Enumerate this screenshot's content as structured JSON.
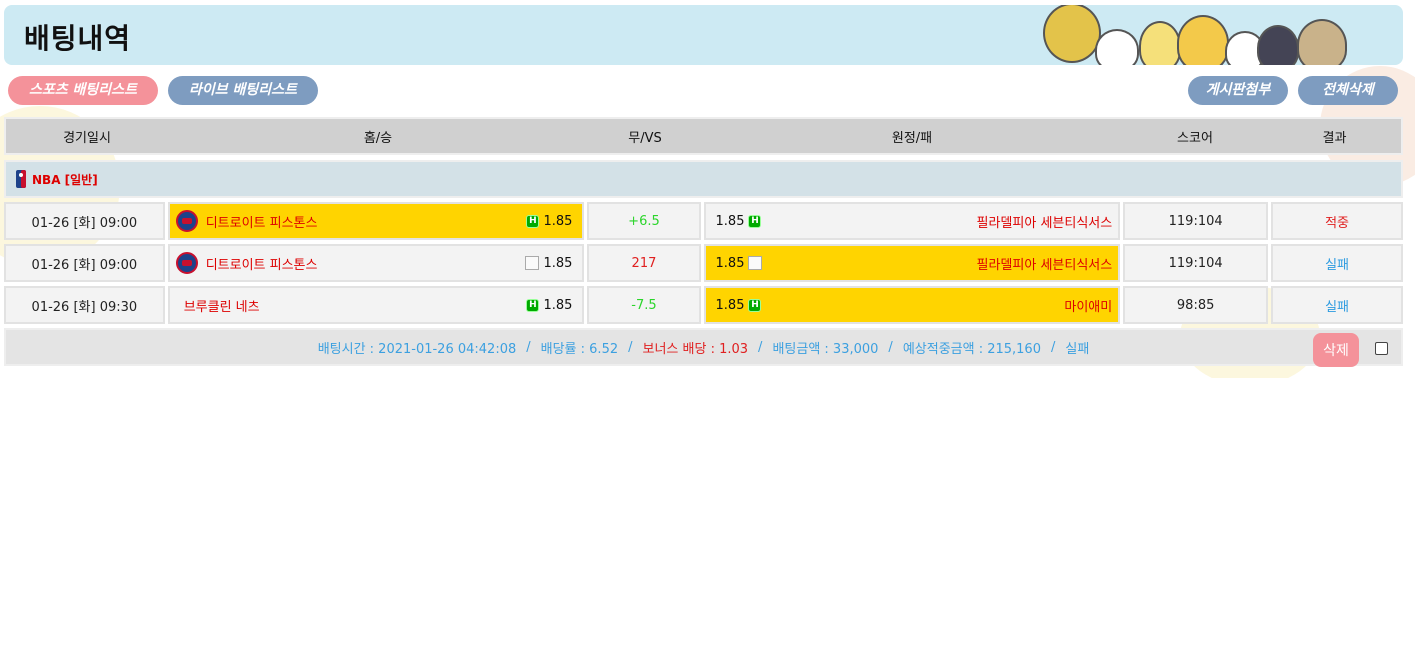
{
  "header": {
    "title": "배팅내역"
  },
  "tabs": {
    "sports": "스포츠 배팅리스트",
    "live": "라이브 배팅리스트"
  },
  "actions": {
    "board_attach": "게시판첨부",
    "delete_all": "전체삭제"
  },
  "columns": [
    "경기일시",
    "홈/승",
    "무/VS",
    "원정/패",
    "스코어",
    "결과"
  ],
  "league": {
    "name": "NBA [일반]"
  },
  "rows": [
    {
      "time": "01-26 [화] 09:00",
      "home": "디트로이트 피스톤스",
      "home_odds": "1.85",
      "mid": "+6.5",
      "away_odds": "1.85",
      "away": "필라델피아 세븐티식서스",
      "score": "119:104",
      "result": "적중"
    },
    {
      "time": "01-26 [화] 09:00",
      "home": "디트로이트 피스톤스",
      "home_odds": "1.85",
      "mid": "217",
      "away_odds": "1.85",
      "away": "필라델피아 세븐티식서스",
      "score": "119:104",
      "result": "실패"
    },
    {
      "time": "01-26 [화] 09:30",
      "home": "브루클린 네츠",
      "home_odds": "1.85",
      "mid": "-7.5",
      "away_odds": "1.85",
      "away": "마이애미",
      "score": "98:85",
      "result": "실패"
    }
  ],
  "summary": {
    "bet_time": "배팅시간 : 2021-01-26 04:42:08",
    "rate": "배당률 : 6.52",
    "bonus": "보너스 배당 : 1.03",
    "amount": "배팅금액 : 33,000",
    "expected": "예상적중금액 : 215,160",
    "status": "실패",
    "sep": "/",
    "delete_label": "삭제"
  },
  "colors": {
    "selected": "#ffd400",
    "pink": "#f4929a",
    "slate": "#7e9cc0",
    "header_bg": "#cdeaf3"
  }
}
